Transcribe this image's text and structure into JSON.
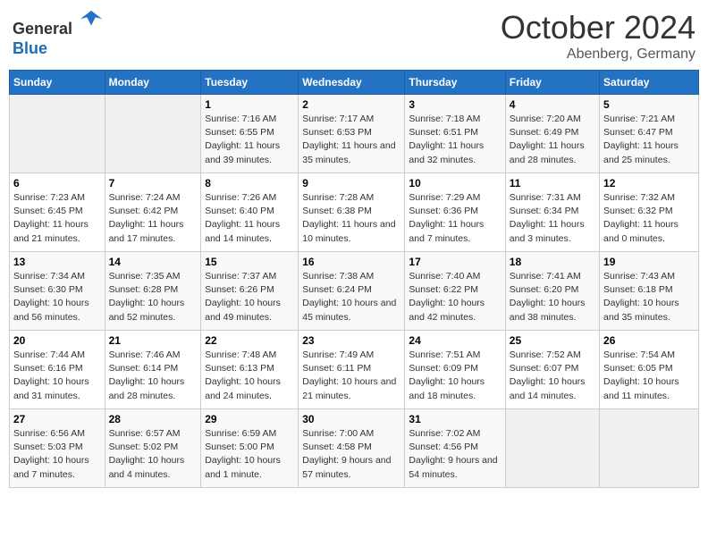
{
  "header": {
    "logo_general": "General",
    "logo_blue": "Blue",
    "month": "October 2024",
    "location": "Abenberg, Germany"
  },
  "days_of_week": [
    "Sunday",
    "Monday",
    "Tuesday",
    "Wednesday",
    "Thursday",
    "Friday",
    "Saturday"
  ],
  "weeks": [
    [
      {
        "day": "",
        "info": ""
      },
      {
        "day": "",
        "info": ""
      },
      {
        "day": "1",
        "info": "Sunrise: 7:16 AM\nSunset: 6:55 PM\nDaylight: 11 hours and 39 minutes."
      },
      {
        "day": "2",
        "info": "Sunrise: 7:17 AM\nSunset: 6:53 PM\nDaylight: 11 hours and 35 minutes."
      },
      {
        "day": "3",
        "info": "Sunrise: 7:18 AM\nSunset: 6:51 PM\nDaylight: 11 hours and 32 minutes."
      },
      {
        "day": "4",
        "info": "Sunrise: 7:20 AM\nSunset: 6:49 PM\nDaylight: 11 hours and 28 minutes."
      },
      {
        "day": "5",
        "info": "Sunrise: 7:21 AM\nSunset: 6:47 PM\nDaylight: 11 hours and 25 minutes."
      }
    ],
    [
      {
        "day": "6",
        "info": "Sunrise: 7:23 AM\nSunset: 6:45 PM\nDaylight: 11 hours and 21 minutes."
      },
      {
        "day": "7",
        "info": "Sunrise: 7:24 AM\nSunset: 6:42 PM\nDaylight: 11 hours and 17 minutes."
      },
      {
        "day": "8",
        "info": "Sunrise: 7:26 AM\nSunset: 6:40 PM\nDaylight: 11 hours and 14 minutes."
      },
      {
        "day": "9",
        "info": "Sunrise: 7:28 AM\nSunset: 6:38 PM\nDaylight: 11 hours and 10 minutes."
      },
      {
        "day": "10",
        "info": "Sunrise: 7:29 AM\nSunset: 6:36 PM\nDaylight: 11 hours and 7 minutes."
      },
      {
        "day": "11",
        "info": "Sunrise: 7:31 AM\nSunset: 6:34 PM\nDaylight: 11 hours and 3 minutes."
      },
      {
        "day": "12",
        "info": "Sunrise: 7:32 AM\nSunset: 6:32 PM\nDaylight: 11 hours and 0 minutes."
      }
    ],
    [
      {
        "day": "13",
        "info": "Sunrise: 7:34 AM\nSunset: 6:30 PM\nDaylight: 10 hours and 56 minutes."
      },
      {
        "day": "14",
        "info": "Sunrise: 7:35 AM\nSunset: 6:28 PM\nDaylight: 10 hours and 52 minutes."
      },
      {
        "day": "15",
        "info": "Sunrise: 7:37 AM\nSunset: 6:26 PM\nDaylight: 10 hours and 49 minutes."
      },
      {
        "day": "16",
        "info": "Sunrise: 7:38 AM\nSunset: 6:24 PM\nDaylight: 10 hours and 45 minutes."
      },
      {
        "day": "17",
        "info": "Sunrise: 7:40 AM\nSunset: 6:22 PM\nDaylight: 10 hours and 42 minutes."
      },
      {
        "day": "18",
        "info": "Sunrise: 7:41 AM\nSunset: 6:20 PM\nDaylight: 10 hours and 38 minutes."
      },
      {
        "day": "19",
        "info": "Sunrise: 7:43 AM\nSunset: 6:18 PM\nDaylight: 10 hours and 35 minutes."
      }
    ],
    [
      {
        "day": "20",
        "info": "Sunrise: 7:44 AM\nSunset: 6:16 PM\nDaylight: 10 hours and 31 minutes."
      },
      {
        "day": "21",
        "info": "Sunrise: 7:46 AM\nSunset: 6:14 PM\nDaylight: 10 hours and 28 minutes."
      },
      {
        "day": "22",
        "info": "Sunrise: 7:48 AM\nSunset: 6:13 PM\nDaylight: 10 hours and 24 minutes."
      },
      {
        "day": "23",
        "info": "Sunrise: 7:49 AM\nSunset: 6:11 PM\nDaylight: 10 hours and 21 minutes."
      },
      {
        "day": "24",
        "info": "Sunrise: 7:51 AM\nSunset: 6:09 PM\nDaylight: 10 hours and 18 minutes."
      },
      {
        "day": "25",
        "info": "Sunrise: 7:52 AM\nSunset: 6:07 PM\nDaylight: 10 hours and 14 minutes."
      },
      {
        "day": "26",
        "info": "Sunrise: 7:54 AM\nSunset: 6:05 PM\nDaylight: 10 hours and 11 minutes."
      }
    ],
    [
      {
        "day": "27",
        "info": "Sunrise: 6:56 AM\nSunset: 5:03 PM\nDaylight: 10 hours and 7 minutes."
      },
      {
        "day": "28",
        "info": "Sunrise: 6:57 AM\nSunset: 5:02 PM\nDaylight: 10 hours and 4 minutes."
      },
      {
        "day": "29",
        "info": "Sunrise: 6:59 AM\nSunset: 5:00 PM\nDaylight: 10 hours and 1 minute."
      },
      {
        "day": "30",
        "info": "Sunrise: 7:00 AM\nSunset: 4:58 PM\nDaylight: 9 hours and 57 minutes."
      },
      {
        "day": "31",
        "info": "Sunrise: 7:02 AM\nSunset: 4:56 PM\nDaylight: 9 hours and 54 minutes."
      },
      {
        "day": "",
        "info": ""
      },
      {
        "day": "",
        "info": ""
      }
    ]
  ]
}
